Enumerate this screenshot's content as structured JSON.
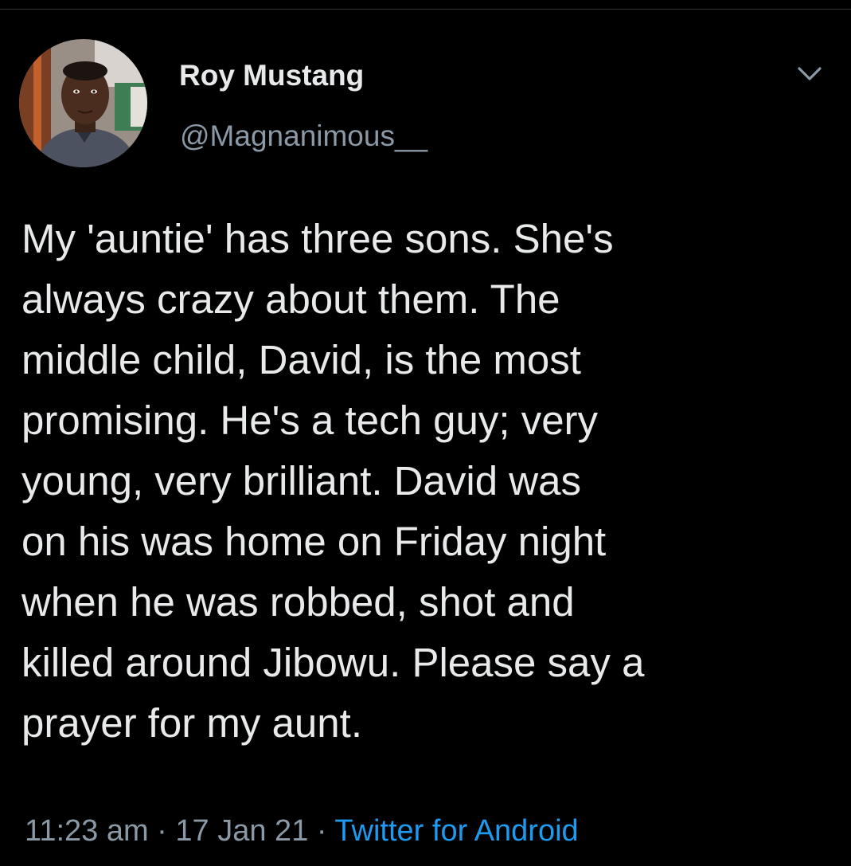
{
  "tweet": {
    "display_name": "Roy Mustang",
    "handle": "@Magnanimous__",
    "text": "My 'auntie' has three sons. She's\nalways crazy about them. The\nmiddle child, David, is the most\npromising. He's a tech guy; very\nyoung, very brilliant. David was\non his was home on Friday night\nwhen he was robbed, shot and\nkilled around Jibowu. Please say a\nprayer for my aunt.",
    "time": "11:23 am",
    "separator_1": " · ",
    "date": "17 Jan 21",
    "separator_2": " · ",
    "source": "Twitter for Android"
  },
  "icons": {
    "more_menu": "chevron-down-icon",
    "avatar": "profile-photo"
  },
  "colors": {
    "background": "#000000",
    "primary_text": "#e7e9ea",
    "secondary_text": "#8b98a5",
    "link": "#1d9bf0"
  }
}
